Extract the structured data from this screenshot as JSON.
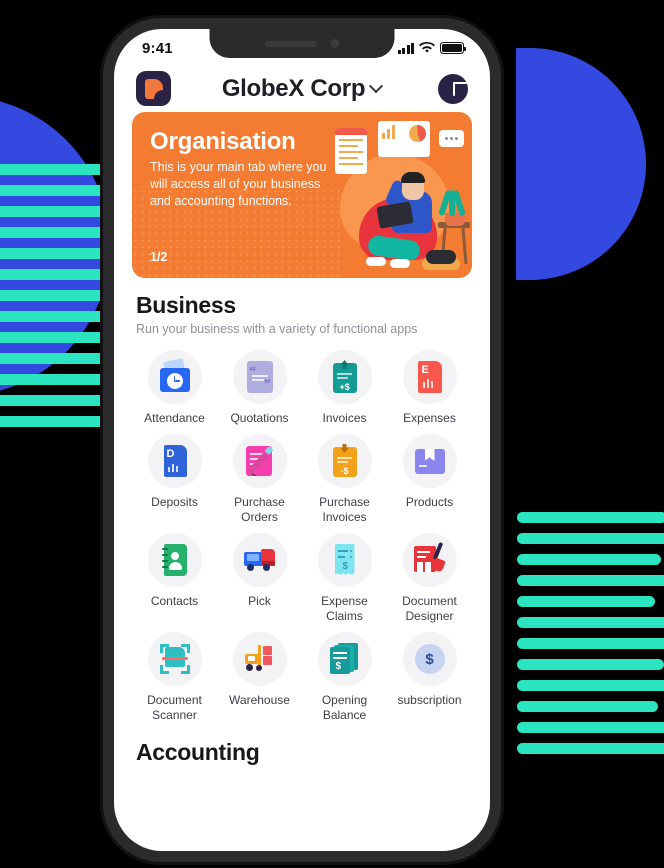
{
  "status_bar": {
    "time": "9:41",
    "signal_icon": "cellular-signal-icon",
    "wifi_icon": "wifi-icon",
    "battery_icon": "battery-icon"
  },
  "header": {
    "logo_icon": "app-logo-icon",
    "org_name": "GlobeX Corp",
    "chevron_icon": "chevron-down-icon",
    "add_icon": "plus-icon"
  },
  "banner": {
    "title": "Organisation",
    "body": "This is your main tab where you will access all of your business and accounting functions.",
    "pager": "1/2",
    "background_color": "#F47B32"
  },
  "business": {
    "title": "Business",
    "subtitle": "Run your business with a variety of functional apps",
    "apps": [
      {
        "label": "Attendance",
        "icon": "attendance-icon",
        "color": "#2668F5"
      },
      {
        "label": "Quotations",
        "icon": "quotations-icon",
        "color": "#B0AEE0"
      },
      {
        "label": "Invoices",
        "icon": "invoices-icon",
        "color": "#149B93"
      },
      {
        "label": "Expenses",
        "icon": "expenses-icon",
        "color": "#F9574B"
      },
      {
        "label": "Deposits",
        "icon": "deposits-icon",
        "color": "#2F63D8"
      },
      {
        "label": "Purchase Orders",
        "icon": "purchase-orders-icon",
        "color": "#F63EAC"
      },
      {
        "label": "Purchase Invoices",
        "icon": "purchase-invoices-icon",
        "color": "#F2A11B"
      },
      {
        "label": "Products",
        "icon": "products-icon",
        "color": "#8B86EE"
      },
      {
        "label": "Contacts",
        "icon": "contacts-icon",
        "color": "#25B16B"
      },
      {
        "label": "Pick",
        "icon": "pick-icon",
        "color": "#E8353C"
      },
      {
        "label": "Expense Claims",
        "icon": "expense-claims-icon",
        "color": "#7FE3F0"
      },
      {
        "label": "Document Designer",
        "icon": "document-designer-icon",
        "color": "#E8353C"
      },
      {
        "label": "Document Scanner",
        "icon": "document-scanner-icon",
        "color": "#2FBFC2"
      },
      {
        "label": "Warehouse",
        "icon": "warehouse-icon",
        "color": "#F2A11B"
      },
      {
        "label": "Opening Balance",
        "icon": "opening-balance-icon",
        "color": "#179A9B"
      },
      {
        "label": "subscription",
        "icon": "subscription-icon",
        "color": "#2B4A9B"
      }
    ]
  },
  "accounting": {
    "title": "Accounting"
  },
  "decor": {
    "blue": "#3449E0",
    "teal": "#2AE5C0"
  }
}
